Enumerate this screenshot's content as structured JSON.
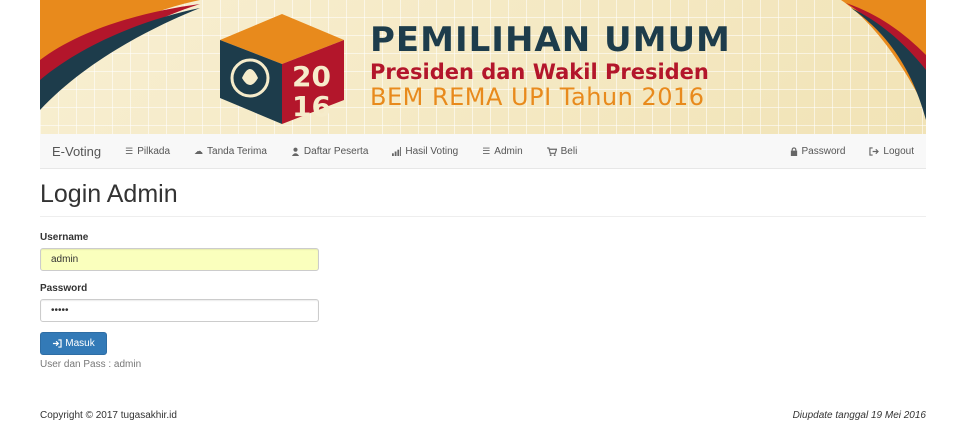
{
  "banner": {
    "title": "PEMILIHAN UMUM",
    "subtitle": "Presiden dan Wakil Presiden",
    "subtitle2": "BEM REMA UPI Tahun 2016",
    "logo_year_top": "20",
    "logo_year_bottom": "16",
    "colors": {
      "navy": "#1d3c4b",
      "red": "#b3162b",
      "orange": "#e88a1c"
    }
  },
  "navbar": {
    "brand": "E-Voting",
    "items": [
      {
        "label": "Pilkada",
        "icon": "list-icon"
      },
      {
        "label": "Tanda Terima",
        "icon": "cloud-icon"
      },
      {
        "label": "Daftar Peserta",
        "icon": "user-icon"
      },
      {
        "label": "Hasil Voting",
        "icon": "signal-icon"
      },
      {
        "label": "Admin",
        "icon": "list-icon"
      },
      {
        "label": "Beli",
        "icon": "cart-icon"
      }
    ],
    "right_items": [
      {
        "label": "Password",
        "icon": "lock-icon"
      },
      {
        "label": "Logout",
        "icon": "logout-icon"
      }
    ]
  },
  "page": {
    "title": "Login Admin",
    "username_label": "Username",
    "username_value": "admin",
    "password_label": "Password",
    "password_value": "•••••",
    "submit_label": "Masuk",
    "hint": "User dan Pass : admin"
  },
  "footer": {
    "copyright": "Copyright © 2017 tugasakhir.id",
    "updated": "Diupdate tanggal 19 Mei 2016"
  }
}
